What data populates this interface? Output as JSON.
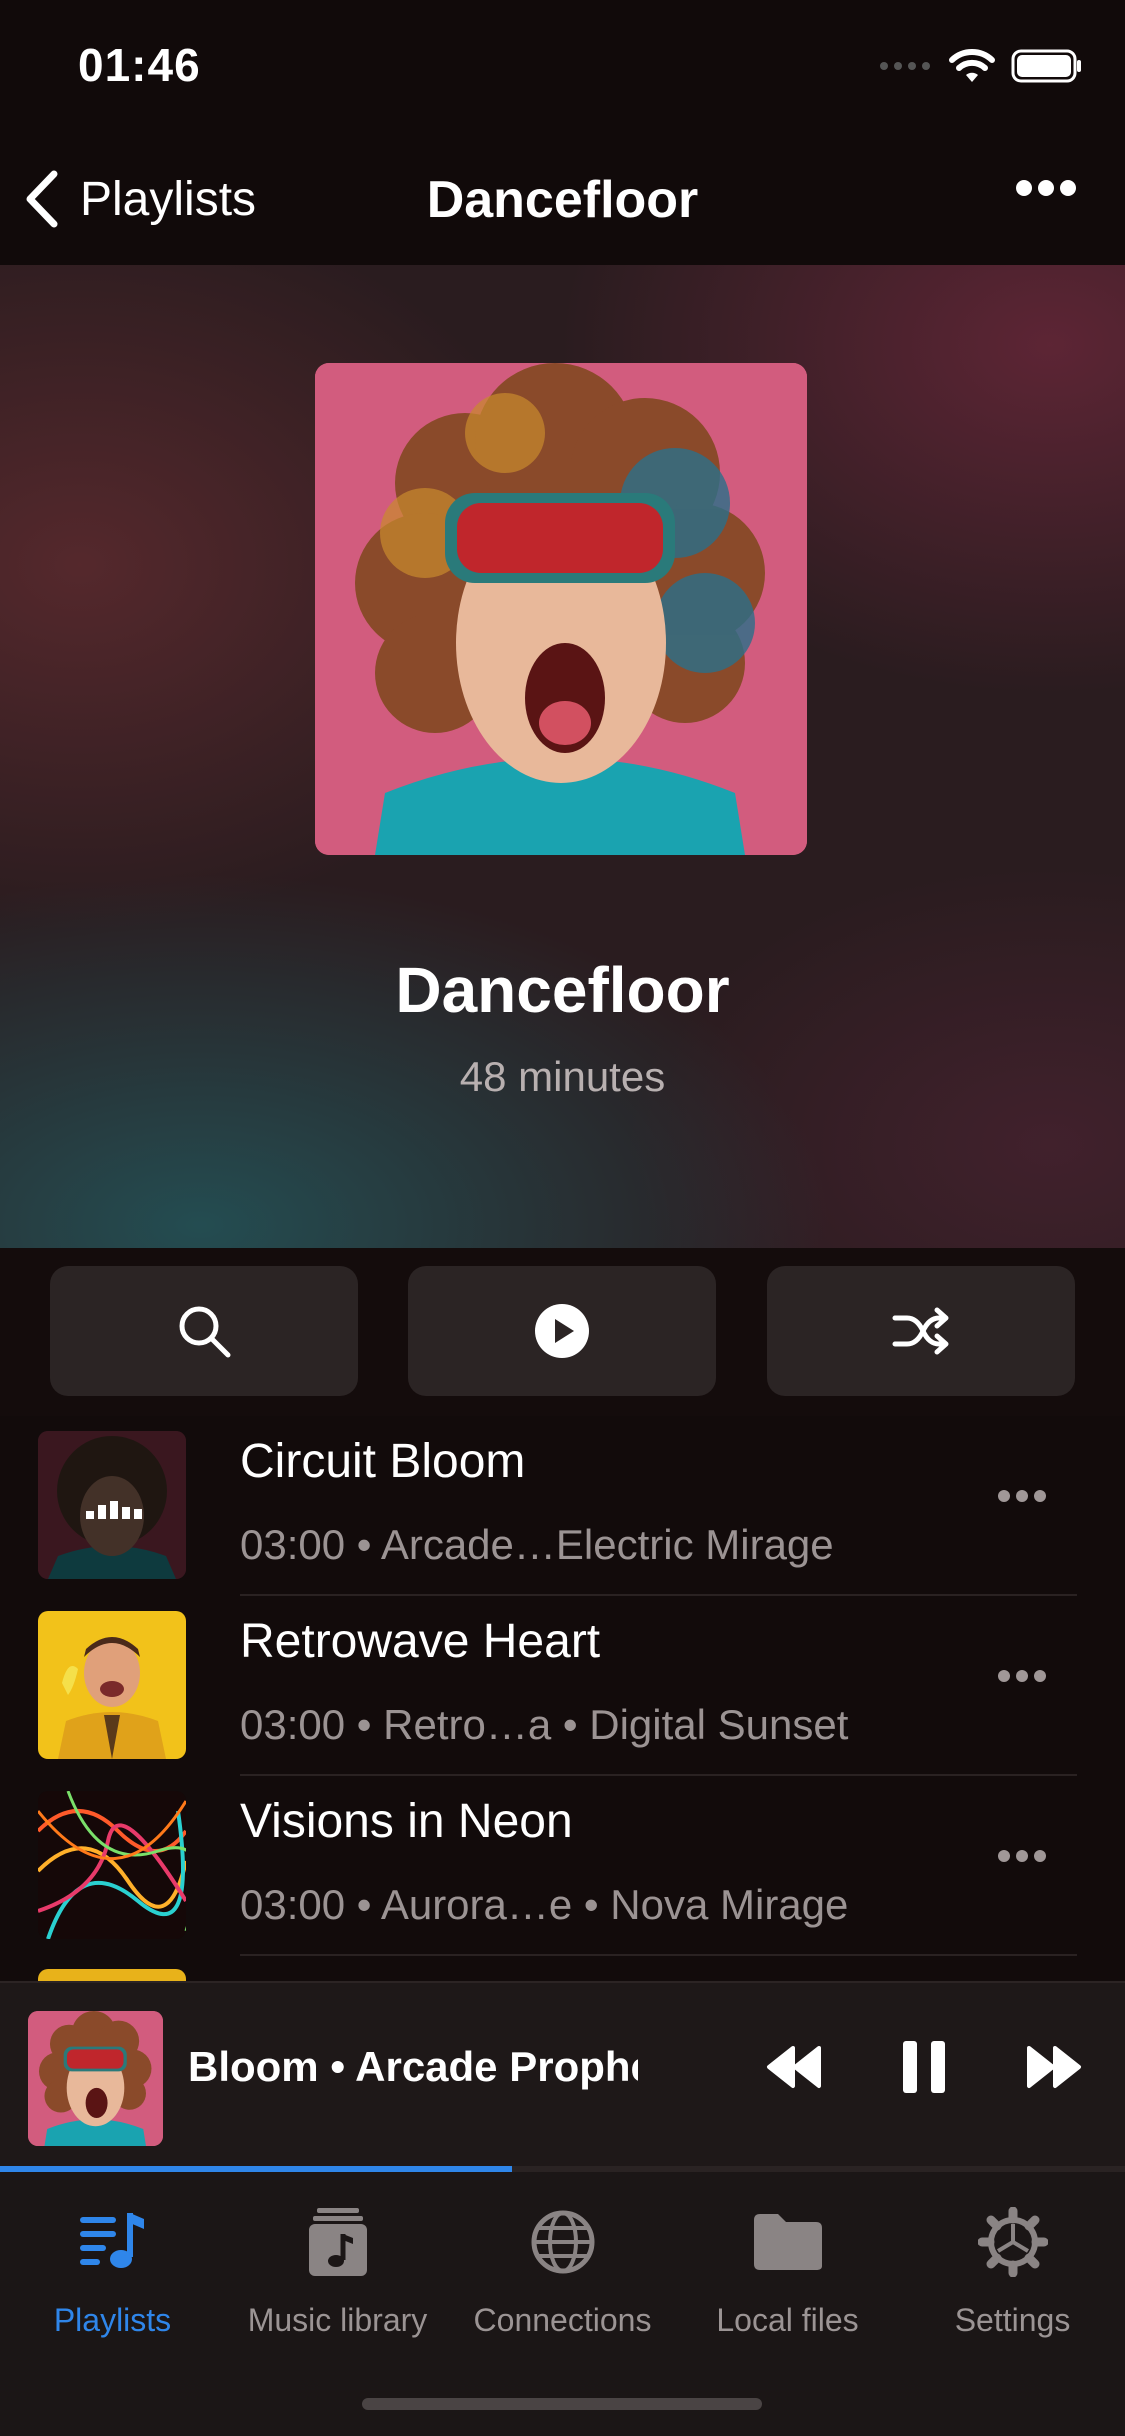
{
  "status": {
    "time": "01:46",
    "signal_icon": "cellular-signal-icon",
    "wifi_icon": "wifi-icon",
    "battery_icon": "battery-icon"
  },
  "nav": {
    "back_label": "Playlists",
    "title": "Dancefloor",
    "more_icon": "ellipsis-icon"
  },
  "playlist": {
    "title": "Dancefloor",
    "duration": "48 minutes",
    "cover_icon": "playlist-cover-image"
  },
  "actions": [
    {
      "icon": "search-icon"
    },
    {
      "icon": "play-circle-icon"
    },
    {
      "icon": "shuffle-icon"
    }
  ],
  "tracks": [
    {
      "title": "Circuit Bloom",
      "meta": "03:00 • Arcade…Electric Mirage",
      "now_playing": true
    },
    {
      "title": "Retrowave Heart",
      "meta": "03:00 • Retro…a • Digital Sunset",
      "now_playing": false
    },
    {
      "title": "Visions in Neon",
      "meta": "03:00 • Aurora…e • Nova Mirage",
      "now_playing": false
    }
  ],
  "mini_player": {
    "text": "Bloom • Arcade Prophe",
    "progress": 0.455,
    "rewind_icon": "rewind-icon",
    "pause_icon": "pause-icon",
    "forward_icon": "fast-forward-icon"
  },
  "tabs": [
    {
      "label": "Playlists",
      "icon": "playlist-music-icon",
      "active": true
    },
    {
      "label": "Music library",
      "icon": "music-library-icon",
      "active": false
    },
    {
      "label": "Connections",
      "icon": "globe-icon",
      "active": false
    },
    {
      "label": "Local files",
      "icon": "folder-icon",
      "active": false
    },
    {
      "label": "Settings",
      "icon": "gear-icon",
      "active": false
    }
  ],
  "colors": {
    "accent": "#2f86ea",
    "cover_pink": "#d25c7e",
    "shirt_teal": "#1aa3b0"
  }
}
